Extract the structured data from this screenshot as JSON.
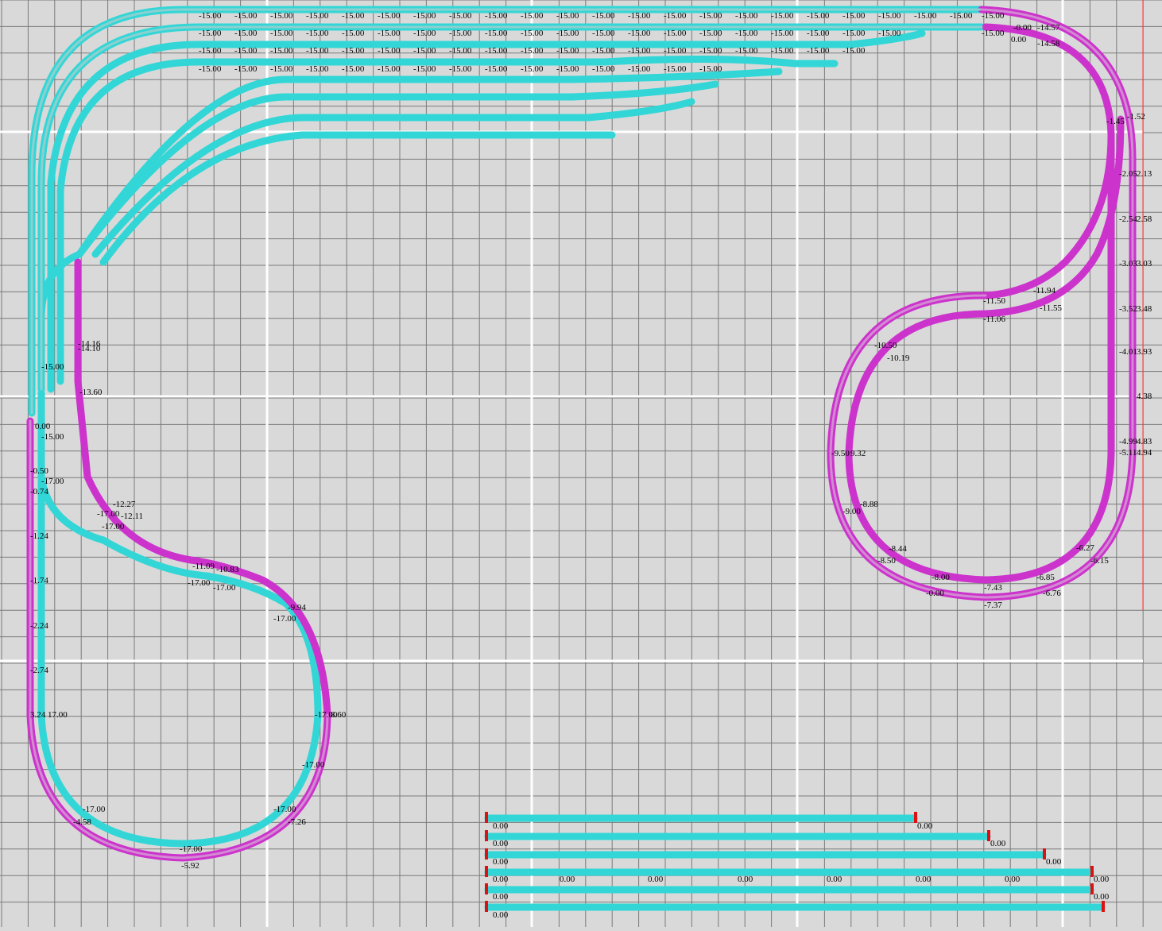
{
  "canvas": {
    "background": "#d9d9d9",
    "grid_color": "#7a7a7a",
    "major_grid_color": "#ffffff",
    "boundary_color": "#ff3333"
  },
  "colors": {
    "level_track": "#33d6d6",
    "grade_track": "#cc33cc",
    "endstop": "#dd1111"
  },
  "labels_top_rows": [
    [
      "-15.00",
      "-15.00",
      "-15.00",
      "-15.00",
      "-15.00",
      "-15.00",
      "-15.00",
      "-15.00",
      "-15.00",
      "-15.00",
      "-15.00",
      "-15.00",
      "-15.00",
      "-15.00",
      "-15.00",
      "-15.00",
      "-15.00",
      "-15.00",
      "-15.00",
      "-15.00",
      "-15.00",
      "-15.00"
    ],
    [
      "-15.00",
      "-15.00",
      "-15.00",
      "-15.00",
      "-15.00",
      "-15.00",
      "-15.00",
      "-15.00",
      "-15.00",
      "-15.00",
      "-15.00",
      "-15.00",
      "-15.00",
      "-15.00",
      "-15.00",
      "-15.00",
      "-15.00",
      "-15.00",
      "-15.00",
      "-15.00"
    ],
    [
      "-15.00",
      "-15.00",
      "-15.00",
      "-15.00",
      "-15.00",
      "-15.00",
      "-15.00",
      "-15.00",
      "-15.00",
      "-15.00",
      "-15.00",
      "-15.00",
      "-15.00",
      "-15.00",
      "-15.00",
      "-15.00",
      "-15.00",
      "-15.00",
      "-15.00"
    ],
    [
      "-15.00",
      "-15.00",
      "-15.00",
      "-15.00",
      "-15.00",
      "-15.00",
      "-15.00",
      "-15.00",
      "-15.00",
      "-15.00",
      "-15.00",
      "-15.00",
      "-15.00",
      "-15.00",
      "-15.00"
    ]
  ],
  "labels": {
    "top_right": [
      "-15.00",
      "-15.00",
      "-0.00",
      "-14.57",
      "0.00",
      "-14.58"
    ],
    "right_column": [
      "-1.52",
      "-1.45",
      "-2.05",
      "2.13",
      "-2.54",
      "2.58",
      "-3.03",
      "3.03",
      "-3.52",
      "3.48",
      "-4.01",
      "3.93",
      "4.38",
      "-4.99",
      "4.83",
      "-5.11",
      "4.94"
    ],
    "helix_right": [
      "-11.94",
      "-11.50",
      "-11.55",
      "-11.06",
      "-10.50",
      "-10.19",
      "-9.50",
      "9.32",
      "-9.00",
      "-8.88",
      "-8.44",
      "-8.50",
      "-8.00",
      "-7.43",
      "-0.00",
      "-7.37",
      "-6.85",
      "-6.76",
      "-6.27",
      "-6.15"
    ],
    "left_side": [
      "-15.00",
      "-14.16",
      "-14.10",
      "-13.60",
      "0.00",
      "-15.00",
      "-0.50",
      "-17.00",
      "-0.74",
      "-1.24",
      "-1.74",
      "-2.24",
      "-2.74",
      "3.24",
      "17.00"
    ],
    "loop_left": [
      "-12.27",
      "-12.11",
      "-17.00",
      "-17.00",
      "-11.09",
      "-10.83",
      "-17.00",
      "-17.00",
      "-9.94",
      "-17.00",
      "-17.00",
      "8.60",
      "-17.00",
      "-17.00",
      "-7.26",
      "-17.00",
      "-4.58",
      "-17.00",
      "-5.92"
    ],
    "yard": [
      "0.00",
      "0.00",
      "0.00",
      "0.00",
      "0.00",
      "0.00",
      "0.00",
      "0.00",
      "0.00",
      "0.00",
      "0.00",
      "0.00",
      "0.00",
      "0.00",
      "0.00",
      "0.00",
      "0.00"
    ]
  }
}
